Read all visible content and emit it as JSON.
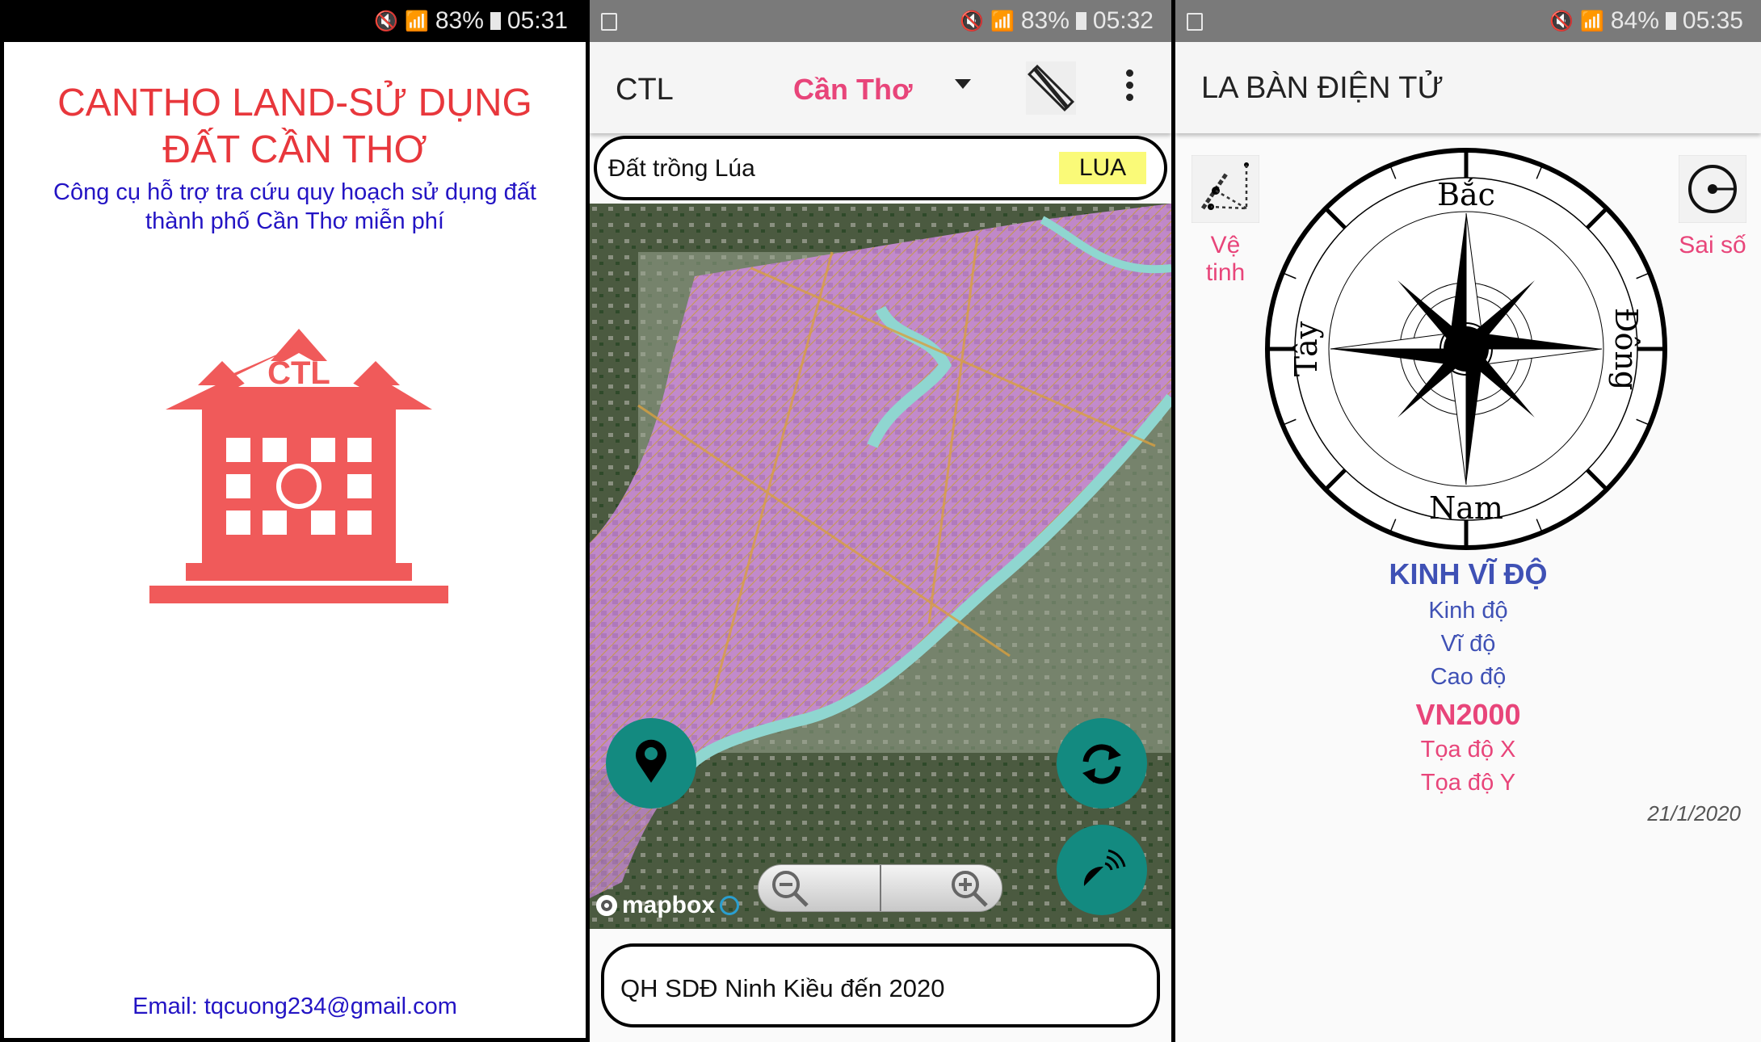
{
  "screen1": {
    "status": {
      "battery": "83%",
      "time": "05:31"
    },
    "title_line1": "CANTHO LAND-SỬ DỤNG",
    "title_line2": "ĐẤT CẦN THƠ",
    "subtitle_line1": "Công cụ hỗ trợ tra cứu quy hoạch sử dụng đất",
    "subtitle_line2": "thành phố Cần Thơ miễn phí",
    "logo_text": "CTL",
    "email": "Email: tqcuong234@gmail.com",
    "colors": {
      "title": "#e8373c",
      "subtitle": "#2314c4",
      "logo": "#f05a5a"
    }
  },
  "screen2": {
    "status": {
      "battery": "83%",
      "time": "05:32"
    },
    "app_title": "CTL",
    "city_select": "Cần Thơ",
    "land_type": "Đất trồng Lúa",
    "land_code": "LUA",
    "map_attribution": "mapbox",
    "layer_name": "QH SDĐ Ninh Kiều đến 2020",
    "icons": [
      "image-icon",
      "ruler-pencil-icon",
      "more-vert-icon",
      "location-pin-icon",
      "refresh-icon",
      "satellite-dish-icon",
      "zoom-out-icon",
      "zoom-in-icon",
      "info-icon"
    ],
    "colors": {
      "accent": "#e8457a",
      "fab": "#138a80",
      "code_bg": "#fafa78"
    }
  },
  "screen3": {
    "status": {
      "battery": "84%",
      "time": "05:35"
    },
    "app_title": "LA BÀN ĐIỆN TỬ",
    "satellite_label_1": "Vệ",
    "satellite_label_2": "tinh",
    "error_label": "Sai số",
    "compass": {
      "north": "Bắc",
      "south": "Nam",
      "east": "Đông",
      "west": "Tây"
    },
    "geo_heading": "KINH VĨ ĐỘ",
    "longitude": "Kinh độ",
    "latitude": "Vĩ độ",
    "altitude": "Cao độ",
    "vn_heading": "VN2000",
    "coord_x": "Tọa độ X",
    "coord_y": "Tọa độ Y",
    "date": "21/1/2020",
    "colors": {
      "blue": "#3f51b5",
      "pink": "#e8457a"
    }
  }
}
